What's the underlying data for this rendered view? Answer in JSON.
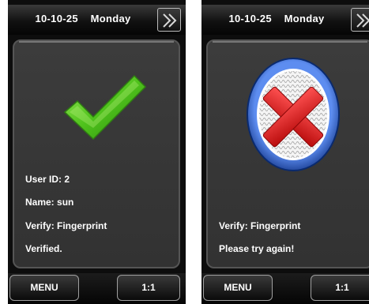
{
  "left_screen": {
    "date": "10-10-25",
    "weekday": "Monday",
    "status_icon": "checkmark-icon",
    "lines": [
      "User ID: 2",
      "Name: sun",
      "Verify: Fingerprint",
      "Verified."
    ],
    "menu_label": "MENU",
    "ratio_label": "1:1",
    "next_icon": "double-chevron-right-icon"
  },
  "right_screen": {
    "date": "10-10-25",
    "weekday": "Monday",
    "status_icon": "fingerprint-fail-icon",
    "lines": [
      "Verify: Fingerprint",
      "Please try again!"
    ],
    "menu_label": "MENU",
    "ratio_label": "1:1",
    "next_icon": "double-chevron-right-icon"
  },
  "colors": {
    "success_green": "#4fc21c",
    "fail_red": "#e01818",
    "ring_blue": "#1f56c8"
  }
}
